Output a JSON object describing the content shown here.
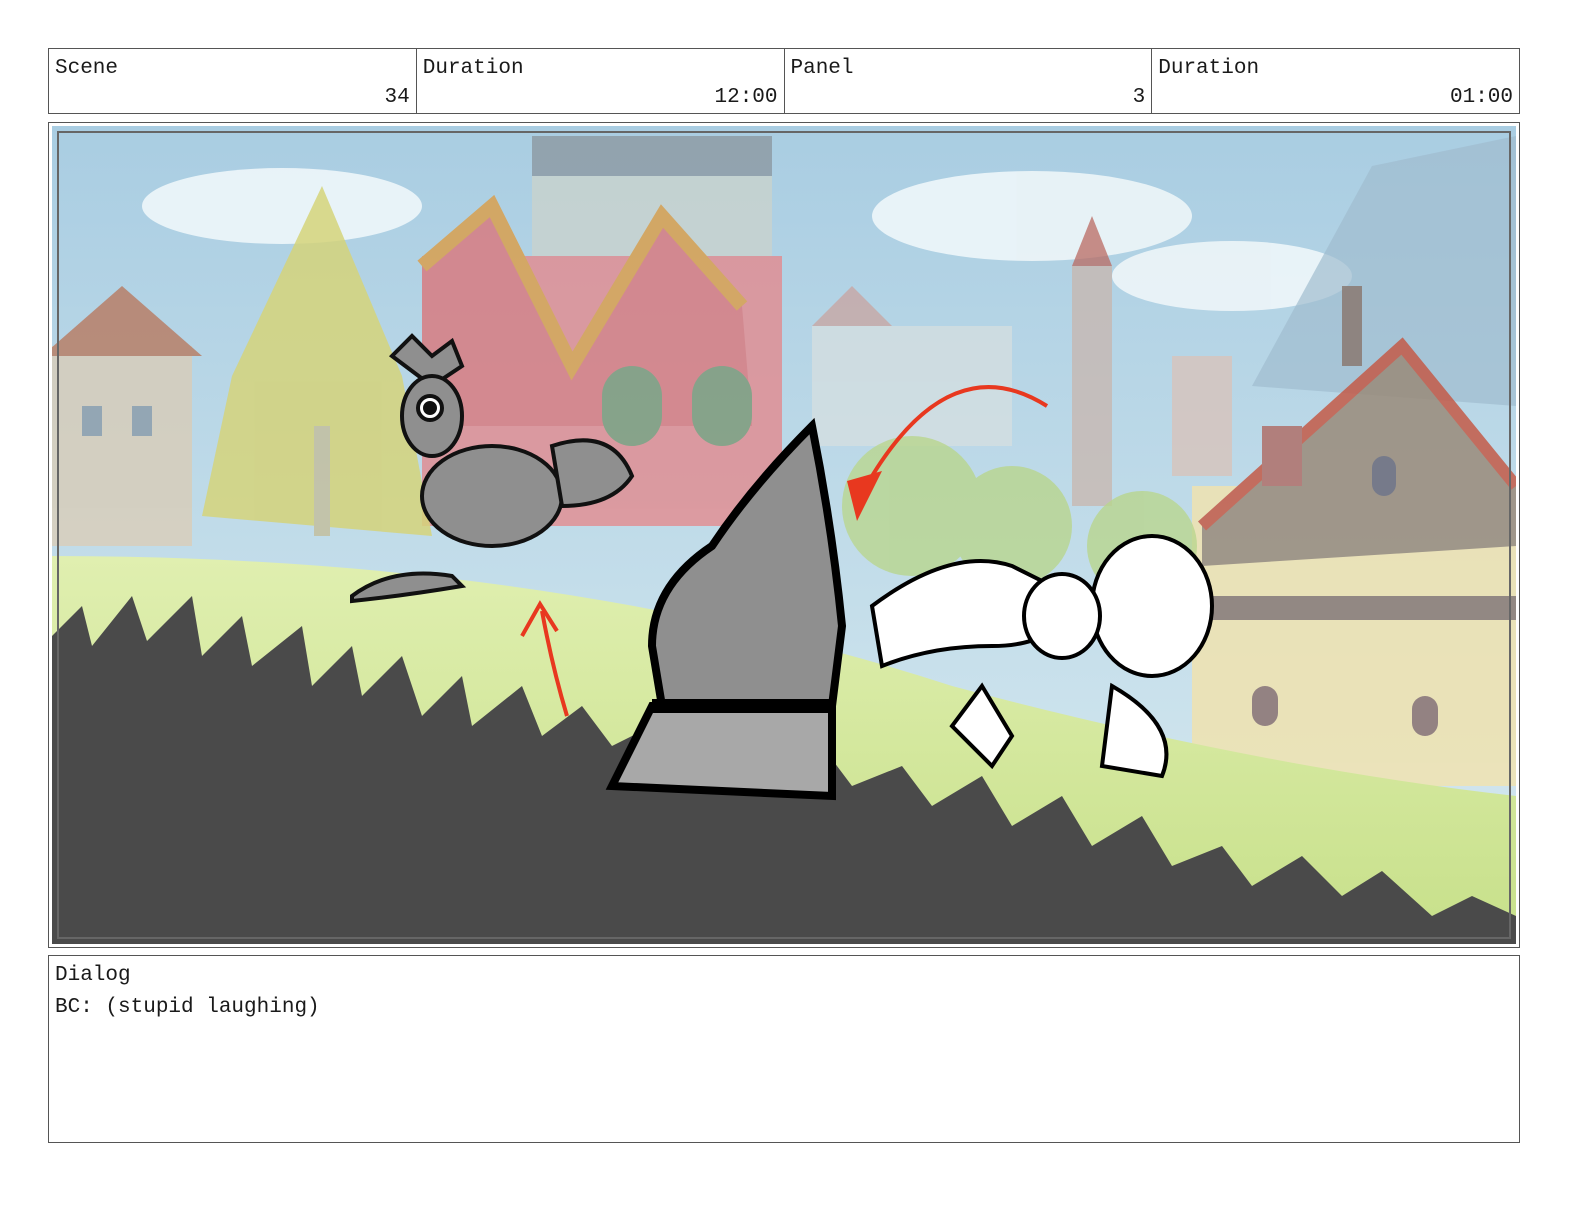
{
  "header": {
    "cells": [
      {
        "label": "Scene",
        "value": "34"
      },
      {
        "label": "Duration",
        "value": "12:00"
      },
      {
        "label": "Panel",
        "value": "3"
      },
      {
        "label": "Duration",
        "value": "01:00"
      }
    ]
  },
  "dialog": {
    "label": "Dialog",
    "text": "BC: (stupid laughing)"
  },
  "colors": {
    "sky": "#bcd9e8",
    "grass_light": "#cfe59a",
    "grass_dark": "#4a4a4a",
    "arrow_red": "#e8381f",
    "gnome_gray": "#8f8f8f"
  }
}
